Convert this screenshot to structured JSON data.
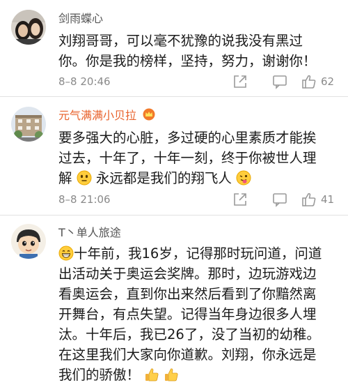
{
  "comments": [
    {
      "username": "剑雨蝶心",
      "line1": "刘翔哥哥，可以毫不犹豫的说我没有黑过",
      "line2": "你。你是我的榜样，坚持，努力，谢谢你！",
      "time": "8–8 20:46",
      "likes": "62",
      "avatar": "couple-photo-avatar"
    },
    {
      "username": "元气满满小贝拉",
      "line1": "要多强大的心脏，多过硬的心里素质才能挨",
      "line2": "过去，十年了，十年一刻，终于你被世人理",
      "line3a": "解",
      "line3b": "永远都是我们的翔飞人",
      "time": "8–8 21:06",
      "likes": "41",
      "avatar": "building-photo-avatar",
      "badge": "vip-crown-icon"
    },
    {
      "username": "T丶单人旅途",
      "line1": "十年前，我16岁，记得那时玩问道，问道",
      "line2": "出活动关于奥运会奖牌。那时，边玩游戏边",
      "line3": "看奥运会，直到你出来然后看到了你黯然离",
      "line4": "开舞台，有点失望。记得当年身边很多人埋",
      "line5": "汰。十年后，我已26了，没了当初的幼稚。",
      "line6": "在这里我们大家向你道歉。刘翔，你永远是",
      "line7": "我们的骄傲！",
      "avatar": "cartoon-boy-avatar"
    }
  ],
  "icons": {
    "share": "share-icon",
    "reply": "reply-icon",
    "like": "thumbs-up-icon"
  }
}
